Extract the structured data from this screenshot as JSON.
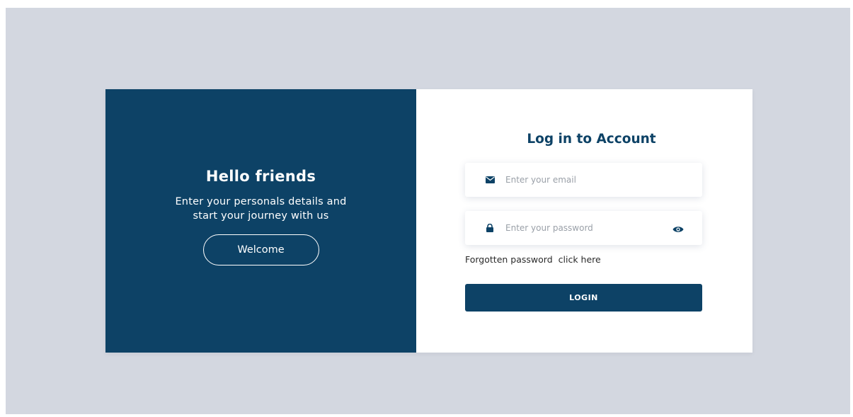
{
  "left": {
    "title": "Hello friends",
    "line1": "Enter your personals details and",
    "line2": "start your journey with us",
    "welcome_label": "Welcome"
  },
  "right": {
    "title": "Log in to Account",
    "email": {
      "placeholder": "Enter your email",
      "value": "",
      "icon": "envelope-icon"
    },
    "password": {
      "placeholder": "Enter your password",
      "value": "",
      "icon": "lock-icon",
      "toggle_icon": "eye-icon"
    },
    "forgot_text": "Forgotten password",
    "forgot_link": "click here",
    "login_label": "LOGIN"
  },
  "colors": {
    "brand": "#0d4266",
    "page_bg": "#d3d7e0",
    "card_bg": "#ffffff"
  }
}
